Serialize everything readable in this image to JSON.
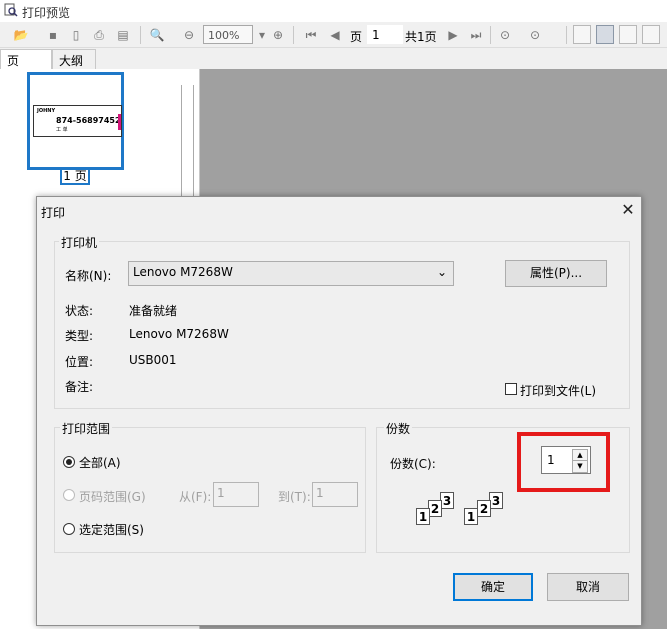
{
  "window": {
    "title": "打印预览"
  },
  "toolbar": {
    "zoom": "100%",
    "page_label": "页",
    "page_value": "1",
    "total_pages": "共1页"
  },
  "tabs": [
    "页",
    "大纲"
  ],
  "thumbnail": {
    "page_label": "1 页",
    "line1": "JOHNY",
    "line2": "874-56897452",
    "line3": "工 单"
  },
  "dialog": {
    "title": "打印",
    "printer": {
      "group": "打印机",
      "name_label": "名称(N):",
      "name_value": "Lenovo M7268W",
      "properties_button": "属性(P)...",
      "status_label": "状态:",
      "status_value": "准备就绪",
      "type_label": "类型:",
      "type_value": "Lenovo M7268W",
      "location_label": "位置:",
      "location_value": "USB001",
      "comment_label": "备注:",
      "print_to_file": "打印到文件(L)"
    },
    "range": {
      "group": "打印范围",
      "all": "全部(A)",
      "pages": "页码范围(G)",
      "from_label": "从(F):",
      "from_value": "1",
      "to_label": "到(T):",
      "to_value": "1",
      "selection": "选定范围(S)"
    },
    "copies": {
      "group": "份数",
      "count_label": "份数(C):",
      "count_value": "1",
      "collate_digits": [
        "1",
        "2",
        "3"
      ]
    },
    "ok_button": "确定",
    "cancel_button": "取消"
  },
  "colors": {
    "accent": "#0078d7",
    "highlight": "#e51a1a",
    "selection": "#1e78c8"
  }
}
